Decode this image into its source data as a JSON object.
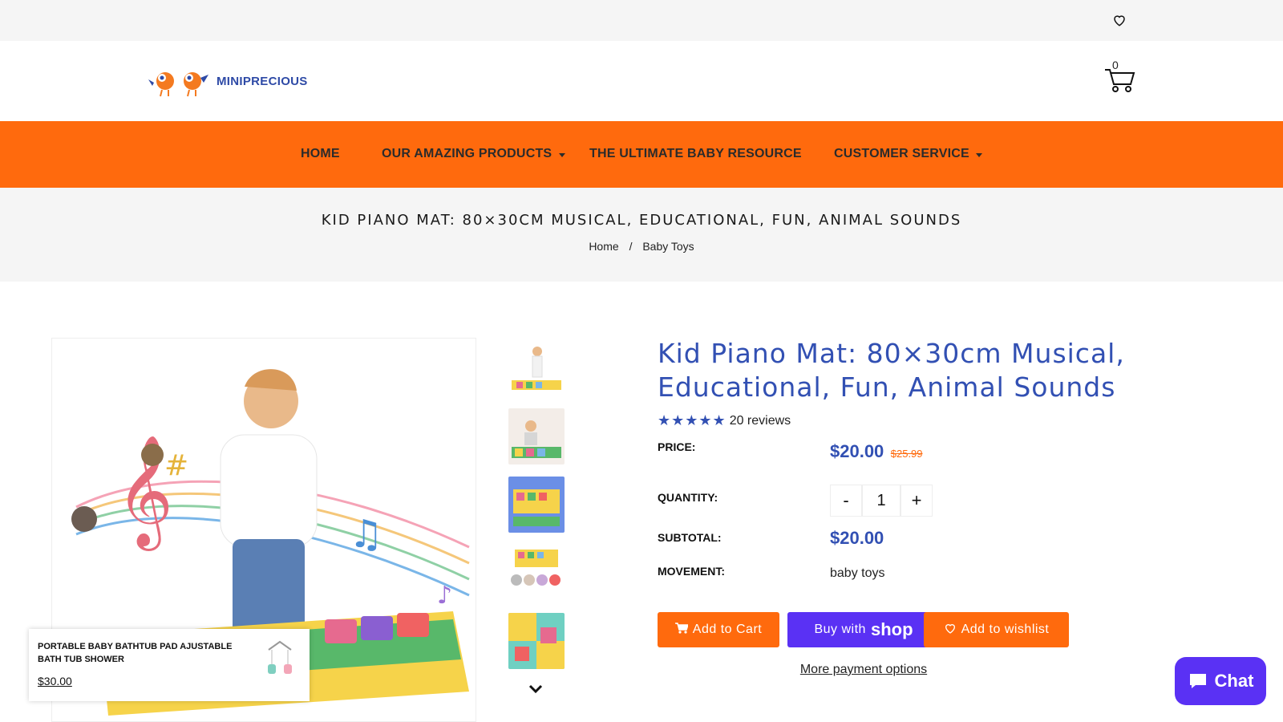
{
  "header": {
    "logo_text": "MINIPRECIOUS",
    "cart_count": "0"
  },
  "nav": {
    "items": [
      {
        "label": "HOME"
      },
      {
        "label": "OUR AMAZING PRODUCTS"
      },
      {
        "label": "THE ULTIMATE BABY RESOURCE"
      },
      {
        "label": "CUSTOMER SERVICE"
      }
    ]
  },
  "hero": {
    "title": "KID PIANO MAT: 80×30CM MUSICAL, EDUCATIONAL, FUN, ANIMAL SOUNDS",
    "breadcrumb": [
      "Home",
      "/",
      "Baby Toys"
    ]
  },
  "product": {
    "title": "Kid Piano Mat: 80×30cm Musical, Educational, Fun, Animal Sounds",
    "rating_stars": 5,
    "reviews": "20 reviews",
    "price_label": "PRICE:",
    "price": "$20.00",
    "compare_price": "$25.99",
    "quantity_label": "QUANTITY:",
    "qty_minus": "-",
    "quantity": "1",
    "qty_plus": "+",
    "subtotal_label": "SUBTOTAL:",
    "subtotal": "$20.00",
    "movement_label": "MOVEMENT:",
    "movement": "baby toys",
    "add_to_cart": "Add to Cart",
    "buy_with": "Buy with",
    "shop_word": "shop",
    "add_to_wishlist": "Add to wishlist",
    "more_payment": "More payment options"
  },
  "popup": {
    "title": "PORTABLE BABY BATHTUB PAD AJUSTABLE BATH TUB SHOWER",
    "price": "$30.00"
  },
  "chat": {
    "label": "Chat"
  },
  "colors": {
    "accent": "#ff6a0d",
    "brand_blue": "#3250b3",
    "shop_purple": "#5a31f4"
  }
}
